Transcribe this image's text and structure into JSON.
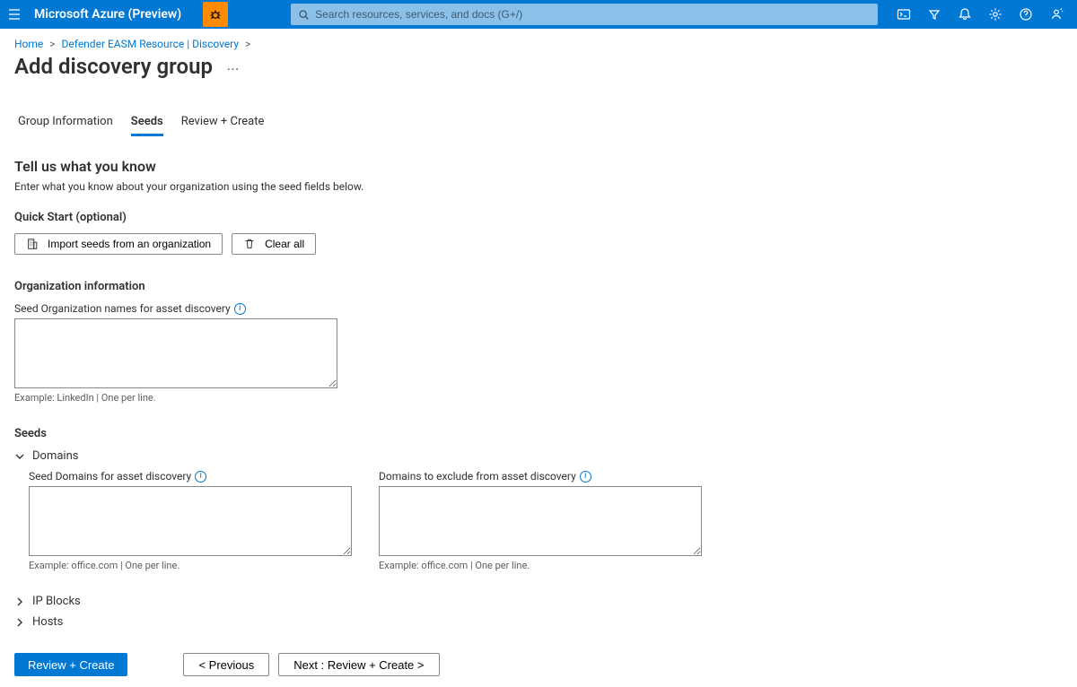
{
  "topbar": {
    "brand": "Microsoft Azure (Preview)",
    "search_placeholder": "Search resources, services, and docs (G+/)"
  },
  "breadcrumb": {
    "items": [
      "Home",
      "Defender EASM Resource | Discovery"
    ]
  },
  "page_title": "Add discovery group",
  "tabs": {
    "items": [
      {
        "label": "Group Information"
      },
      {
        "label": "Seeds"
      },
      {
        "label": "Review + Create"
      }
    ]
  },
  "section": {
    "title": "Tell us what you know",
    "desc": "Enter what you know about your organization using the seed fields below."
  },
  "quickstart": {
    "heading": "Quick Start (optional)",
    "import_label": "Import seeds from an organization",
    "clear_label": "Clear all"
  },
  "org": {
    "heading": "Organization information",
    "field_label": "Seed Organization names for asset discovery",
    "hint": "Example: LinkedIn | One per line."
  },
  "seeds": {
    "heading": "Seeds",
    "domains": {
      "label": "Domains",
      "seed_label": "Seed Domains for asset discovery",
      "seed_hint": "Example: office.com | One per line.",
      "exclude_label": "Domains to exclude from asset discovery",
      "exclude_hint": "Example: office.com | One per line."
    },
    "ipblocks_label": "IP Blocks",
    "hosts_label": "Hosts"
  },
  "footer": {
    "review": "Review + Create",
    "previous": "< Previous",
    "next": "Next : Review + Create >"
  }
}
